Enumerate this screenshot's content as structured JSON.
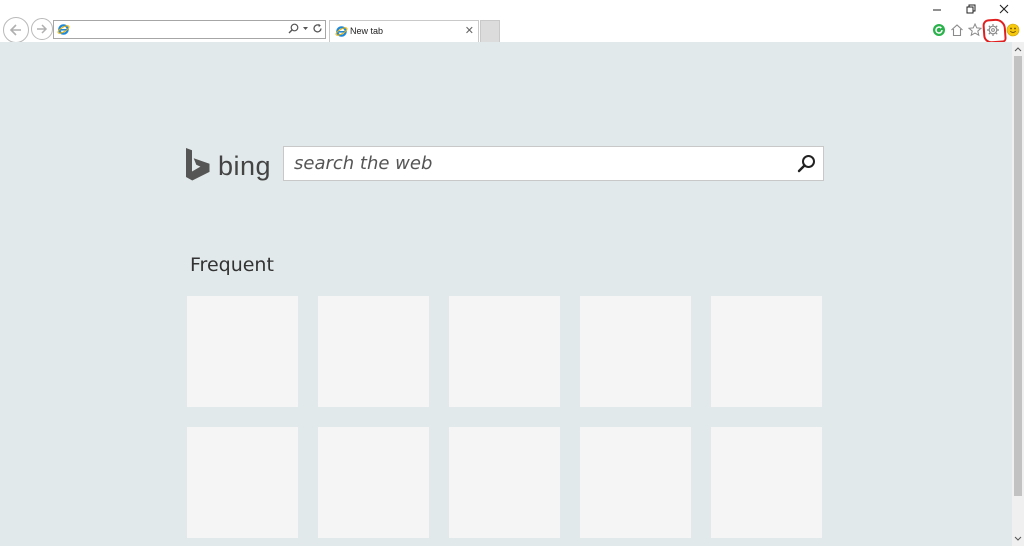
{
  "browser": {
    "tab": {
      "title": "New tab"
    },
    "address_bar": {
      "value": ""
    },
    "toolbar_icons": [
      "back-icon",
      "forward-icon",
      "ie-icon",
      "search-icon",
      "dropdown-icon",
      "refresh-icon",
      "close-icon",
      "refresh-green-icon",
      "home-icon",
      "star-icon",
      "gear-icon",
      "smiley-icon"
    ],
    "highlight_color": "#e02020"
  },
  "page": {
    "logo_text": "bing",
    "search": {
      "placeholder": "search the web",
      "value": ""
    },
    "frequent": {
      "heading": "Frequent"
    },
    "tiles": [
      {
        "label": ""
      },
      {
        "label": ""
      },
      {
        "label": ""
      },
      {
        "label": ""
      },
      {
        "label": ""
      },
      {
        "label": ""
      },
      {
        "label": ""
      },
      {
        "label": ""
      },
      {
        "label": ""
      },
      {
        "label": ""
      }
    ]
  },
  "colors": {
    "page_background": "#e2e9ea",
    "tile_background": "#f5f5f5",
    "bing_logo": "#444444"
  }
}
